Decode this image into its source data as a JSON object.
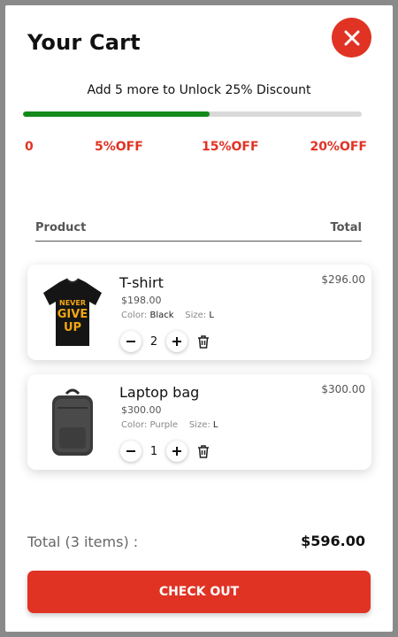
{
  "header": {
    "title": "Your Cart",
    "close_icon": "close-icon"
  },
  "promo": {
    "message": "Add 5 more to Unlock 25% Discount",
    "progress_fraction": 0.55,
    "progress_color": "#138a1a",
    "milestones": [
      "0",
      "5%OFF",
      "15%OFF",
      "20%OFF"
    ]
  },
  "table": {
    "product_header": "Product",
    "total_header": "Total"
  },
  "items": [
    {
      "name": "T-shirt",
      "price": "$198.00",
      "color_label": "Color:",
      "color_value": "Black",
      "size_label": "Size:",
      "size_value": "L",
      "quantity": "2",
      "total": "$296.00",
      "image_icon": "tshirt-image",
      "print_text": [
        "NEVER",
        "GIVE",
        "UP"
      ]
    },
    {
      "name": "Laptop bag",
      "price": "$300.00",
      "color_label": "Color:",
      "color_value": "Purple",
      "size_label": "Size:",
      "size_value": "L",
      "quantity": "1",
      "total": "$300.00",
      "image_icon": "backpack-image"
    }
  ],
  "summary": {
    "label": "Total (3 items) :",
    "value": "$596.00"
  },
  "checkout": {
    "label": "CHECK OUT"
  },
  "colors": {
    "accent": "#e03324",
    "progress": "#138a1a"
  }
}
